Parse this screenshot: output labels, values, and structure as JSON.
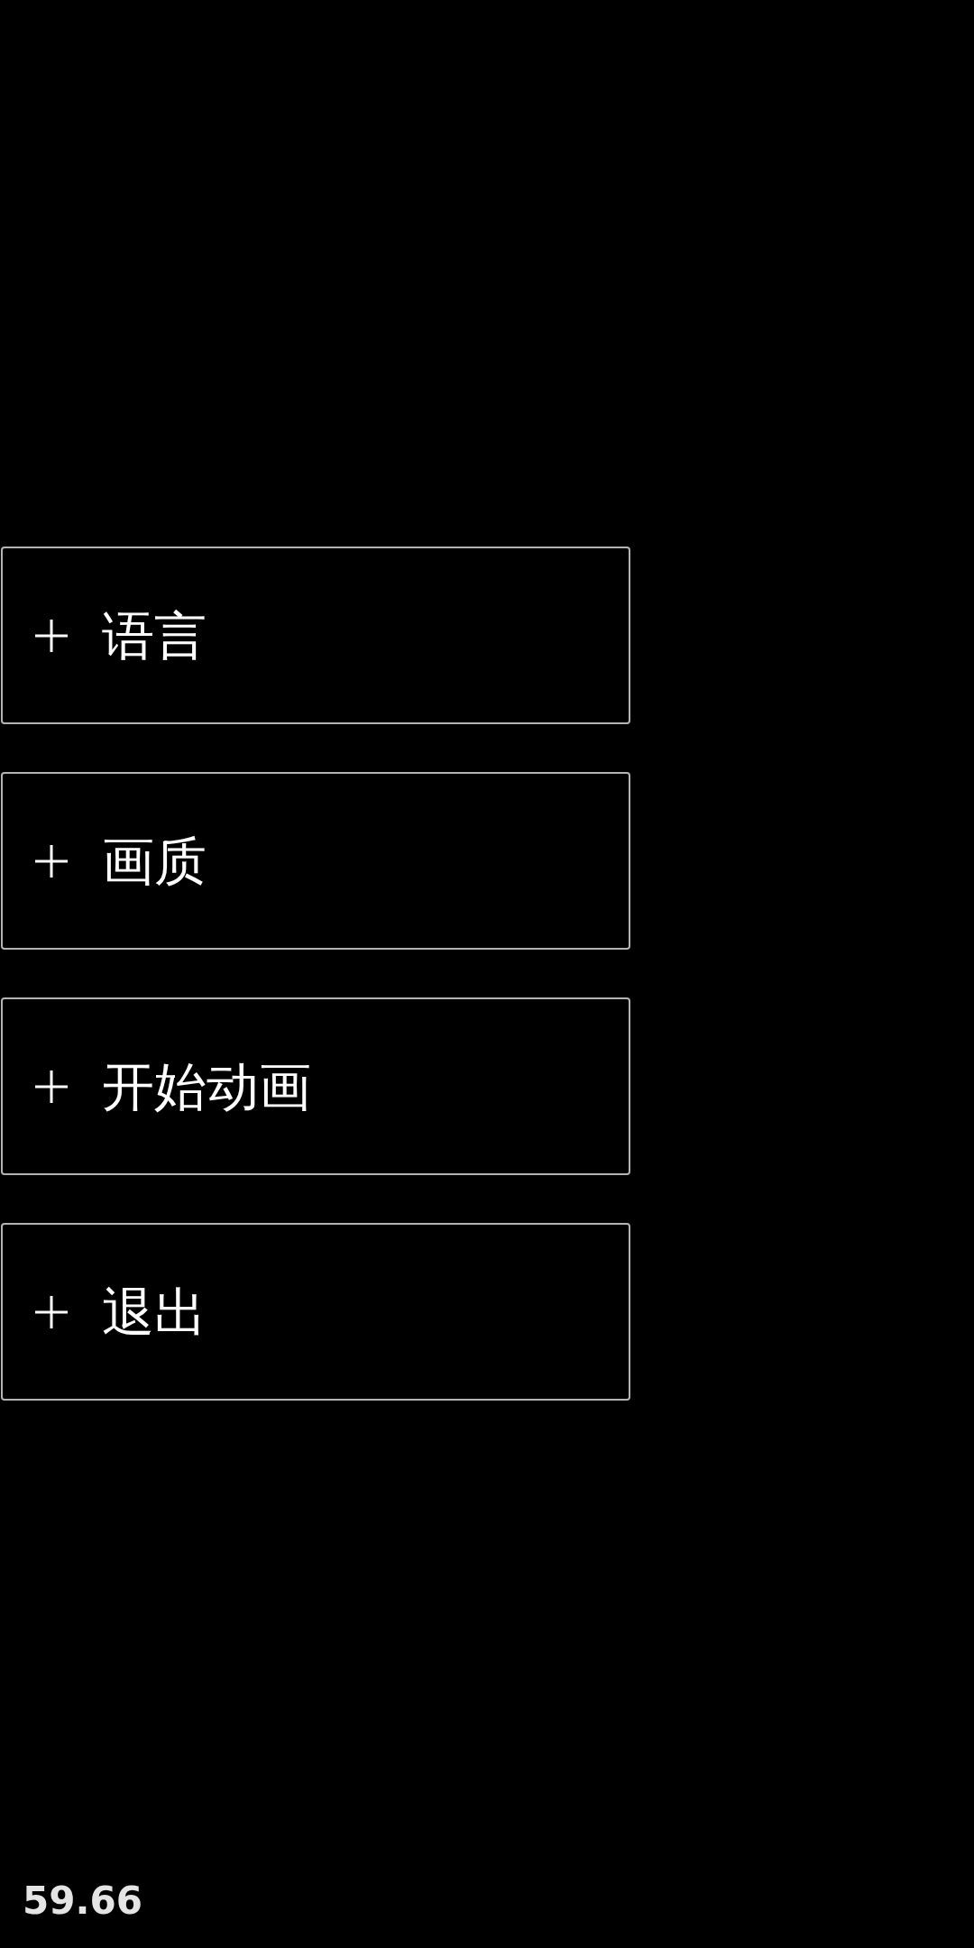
{
  "menu": {
    "buttons": [
      {
        "label": "语言"
      },
      {
        "label": "画质"
      },
      {
        "label": "开始动画"
      },
      {
        "label": "退出"
      }
    ]
  },
  "fps_counter": "59.66"
}
